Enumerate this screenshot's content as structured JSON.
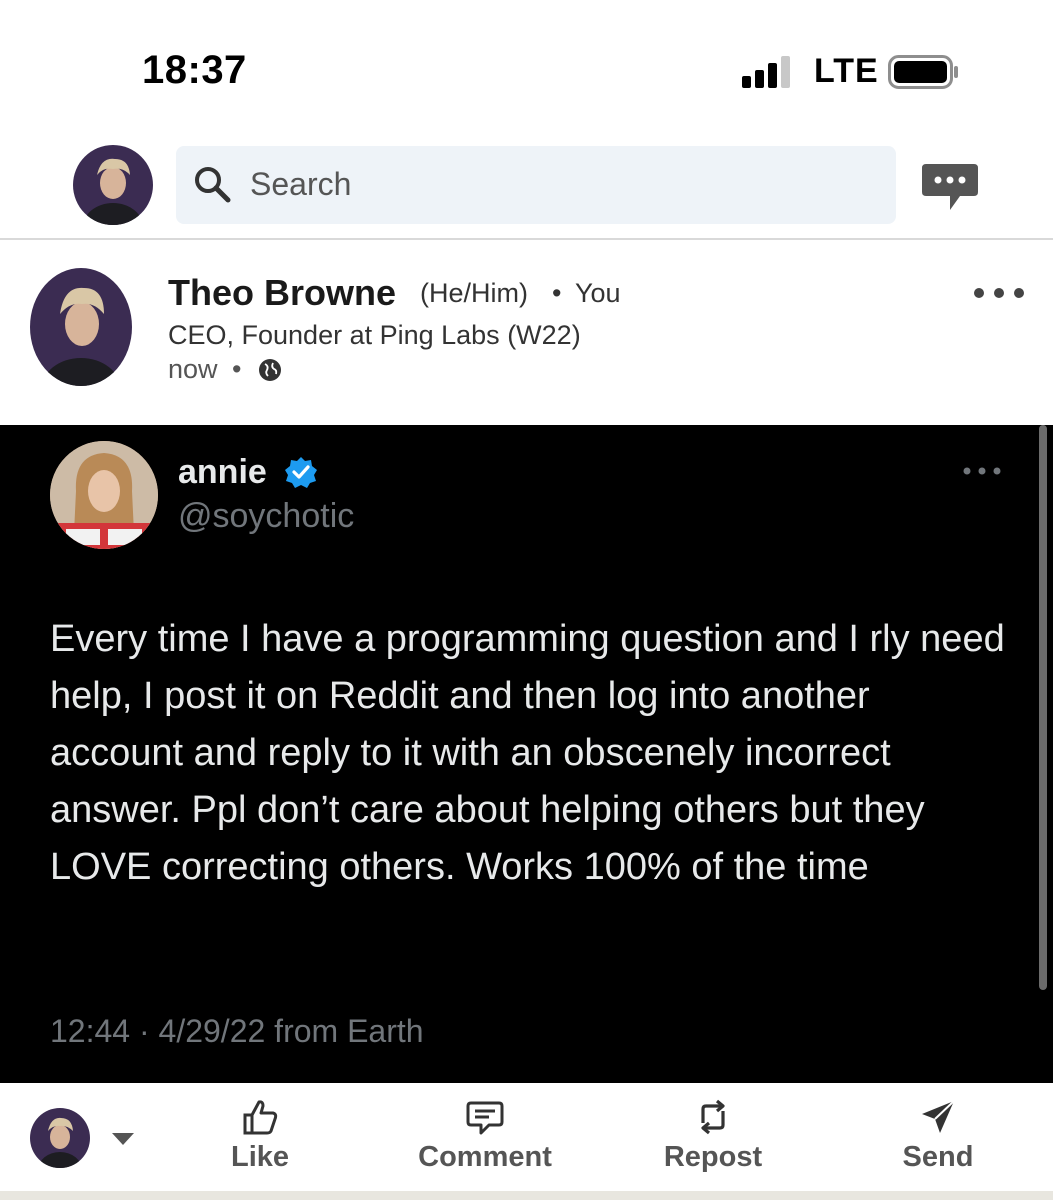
{
  "status_bar": {
    "time": "18:37",
    "network": "LTE"
  },
  "header": {
    "search_placeholder": "Search",
    "icons": [
      "search-icon",
      "messaging-icon"
    ]
  },
  "post": {
    "author_name": "Theo Browne",
    "pronouns": "(He/Him)",
    "separator": "•",
    "relation": "You",
    "headline": "CEO, Founder at Ping Labs (W22)",
    "time": "now",
    "time_separator": "•",
    "visibility_icon": "globe-icon"
  },
  "tweet": {
    "name": "annie",
    "handle": "@soychotic",
    "verified": true,
    "verified_color": "#1d9bf0",
    "text": "Every time I have a programming question and I rly need help, I post it on Reddit and then log into another account and reply to it with an obscenely incorrect answer. Ppl don’t care about helping others but they LOVE correcting others. Works 100% of the time",
    "meta": "12:44 · 4/29/22 from Earth"
  },
  "actions": {
    "like": "Like",
    "comment": "Comment",
    "repost": "Repost",
    "send": "Send"
  },
  "colors": {
    "search_bg": "#eef3f8",
    "tweet_bg": "#000000",
    "tweet_text": "#e7e9ea",
    "tweet_muted": "#71767b"
  }
}
